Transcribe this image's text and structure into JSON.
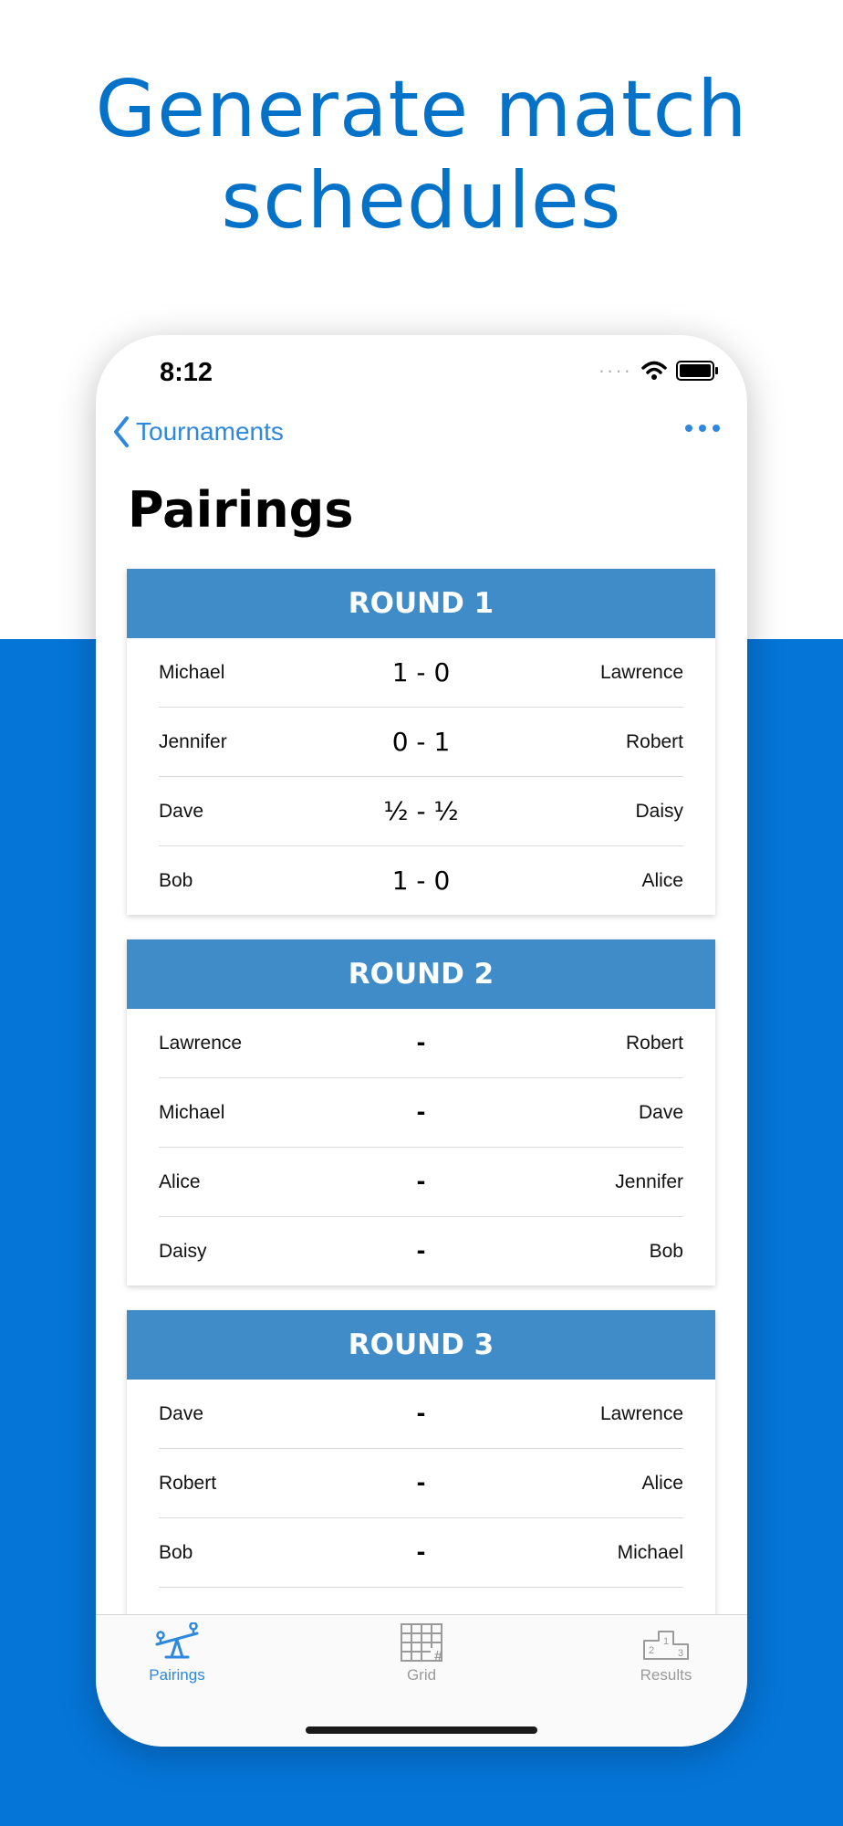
{
  "headline": {
    "line1": "Generate match",
    "line2": "schedules"
  },
  "status": {
    "time": "8:12"
  },
  "nav": {
    "back_label": "Tournaments"
  },
  "title": "Pairings",
  "rounds": [
    {
      "label": "ROUND 1",
      "matches": [
        {
          "left": "Michael",
          "score": "1 - 0",
          "right": "Lawrence"
        },
        {
          "left": "Jennifer",
          "score": "0 - 1",
          "right": "Robert"
        },
        {
          "left": "Dave",
          "score": "½ - ½",
          "right": "Daisy"
        },
        {
          "left": "Bob",
          "score": "1 - 0",
          "right": "Alice"
        }
      ]
    },
    {
      "label": "ROUND 2",
      "matches": [
        {
          "left": "Lawrence",
          "score": "-",
          "right": "Robert"
        },
        {
          "left": "Michael",
          "score": "-",
          "right": "Dave"
        },
        {
          "left": "Alice",
          "score": "-",
          "right": "Jennifer"
        },
        {
          "left": "Daisy",
          "score": "-",
          "right": "Bob"
        }
      ]
    },
    {
      "label": "ROUND 3",
      "matches": [
        {
          "left": "Dave",
          "score": "-",
          "right": "Lawrence"
        },
        {
          "left": "Robert",
          "score": "-",
          "right": "Alice"
        },
        {
          "left": "Bob",
          "score": "-",
          "right": "Michael"
        }
      ]
    }
  ],
  "tabs": [
    {
      "label": "Pairings",
      "icon": "seesaw-icon",
      "active": true
    },
    {
      "label": "Grid",
      "icon": "grid-icon",
      "active": false
    },
    {
      "label": "Results",
      "icon": "podium-icon",
      "active": false
    }
  ],
  "colors": {
    "accent": "#2e88dd",
    "brand_blue": "#0575d8",
    "header_blue": "#3f8cc9",
    "headline": "#0572c9"
  }
}
